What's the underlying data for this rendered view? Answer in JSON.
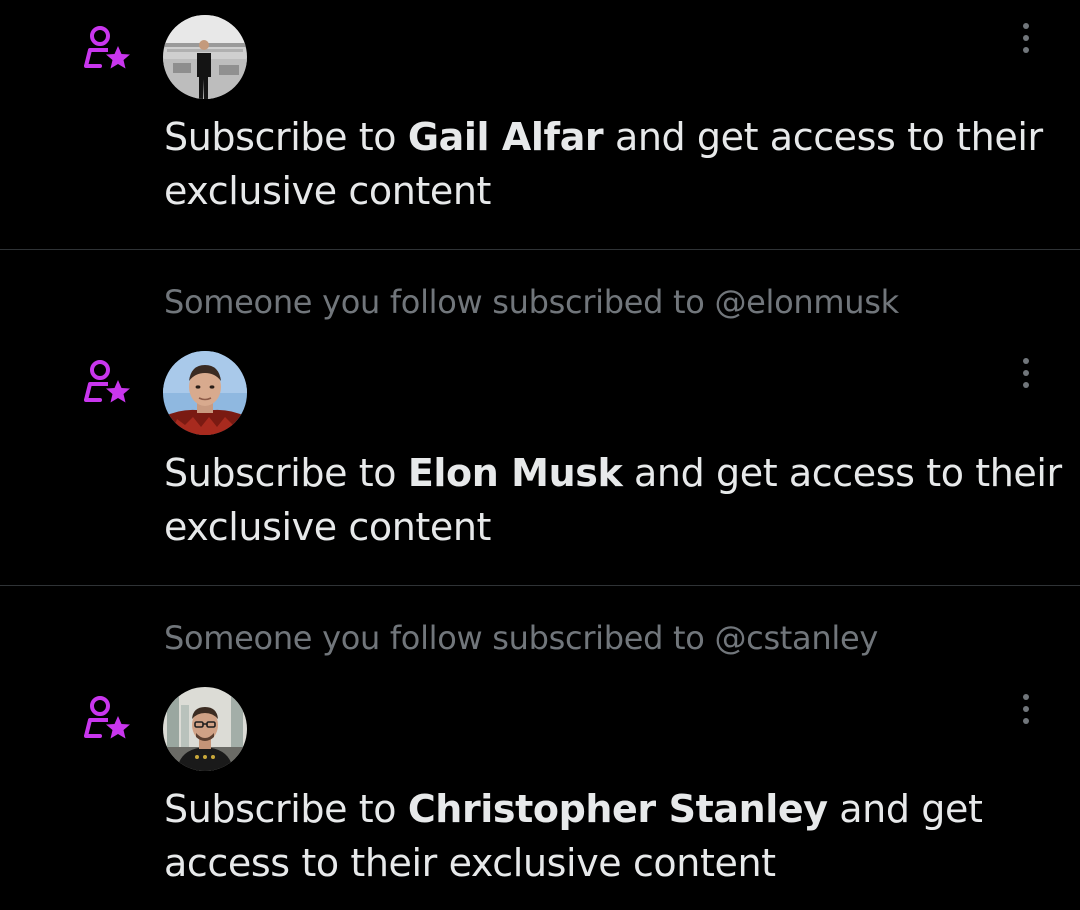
{
  "colors": {
    "background": "#000000",
    "primary_text": "#e7e9ea",
    "secondary_text": "#71767b",
    "divider": "#2f3336",
    "subscription_icon": "#c936ee"
  },
  "items": [
    {
      "context": "",
      "icon": "subscribe-person-star-icon",
      "avatar": "gail-alfar-avatar",
      "message": {
        "prefix": "Subscribe to ",
        "name": "Gail Alfar",
        "suffix": " and get access to their exclusive content"
      }
    },
    {
      "context": "Someone you follow subscribed to @elonmusk",
      "icon": "subscribe-person-star-icon",
      "avatar": "elon-musk-avatar",
      "message": {
        "prefix": "Subscribe to ",
        "name": "Elon Musk",
        "suffix": " and get access to their exclusive content"
      }
    },
    {
      "context": "Someone you follow subscribed to @cstanley",
      "icon": "subscribe-person-star-icon",
      "avatar": "christopher-stanley-avatar",
      "message": {
        "prefix": "Subscribe to ",
        "name": "Christopher Stanley",
        "suffix": " and get access to their exclusive content"
      }
    }
  ]
}
